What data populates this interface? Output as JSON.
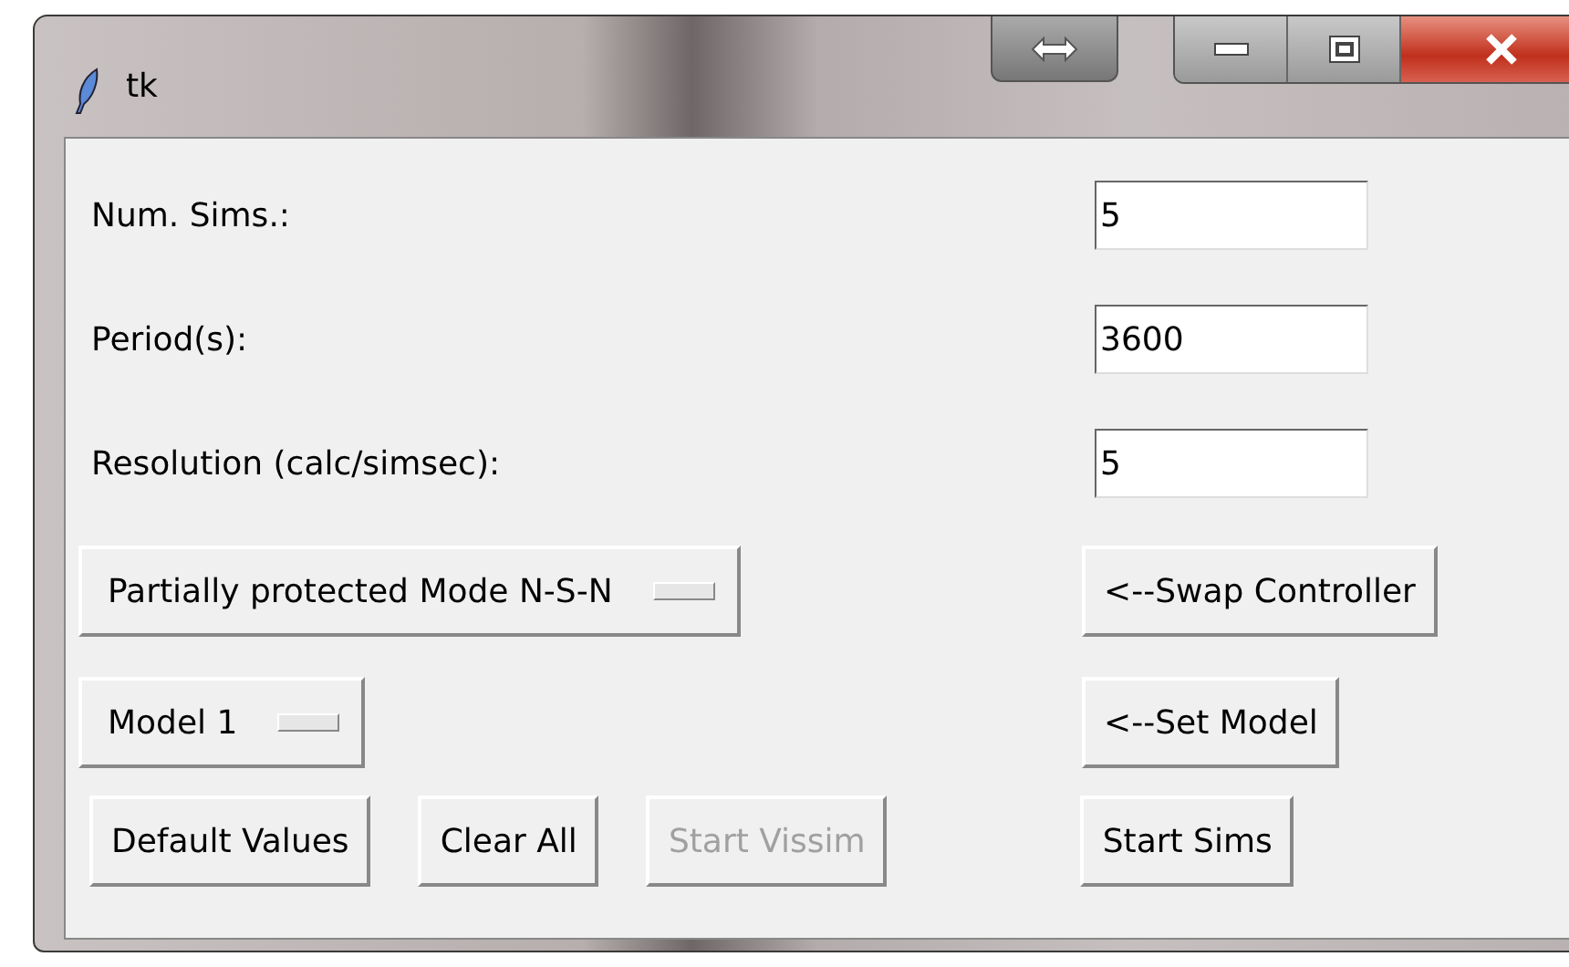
{
  "window": {
    "title": "tk"
  },
  "fields": [
    {
      "label": "Num. Sims.:",
      "value": "5"
    },
    {
      "label": "Period(s):",
      "value": "3600"
    },
    {
      "label": "Resolution (calc/simsec):",
      "value": "5"
    }
  ],
  "selectors": [
    {
      "value": "Partially protected Mode N-S-N",
      "action": "<--Swap Controller"
    },
    {
      "value": "Model 1",
      "action": "<--Set Model"
    }
  ],
  "buttons": [
    {
      "label": "Default Values",
      "disabled": false
    },
    {
      "label": "Clear All",
      "disabled": false
    },
    {
      "label": "Start Vissim",
      "disabled": true
    },
    {
      "label": "Start Sims",
      "disabled": false
    }
  ]
}
